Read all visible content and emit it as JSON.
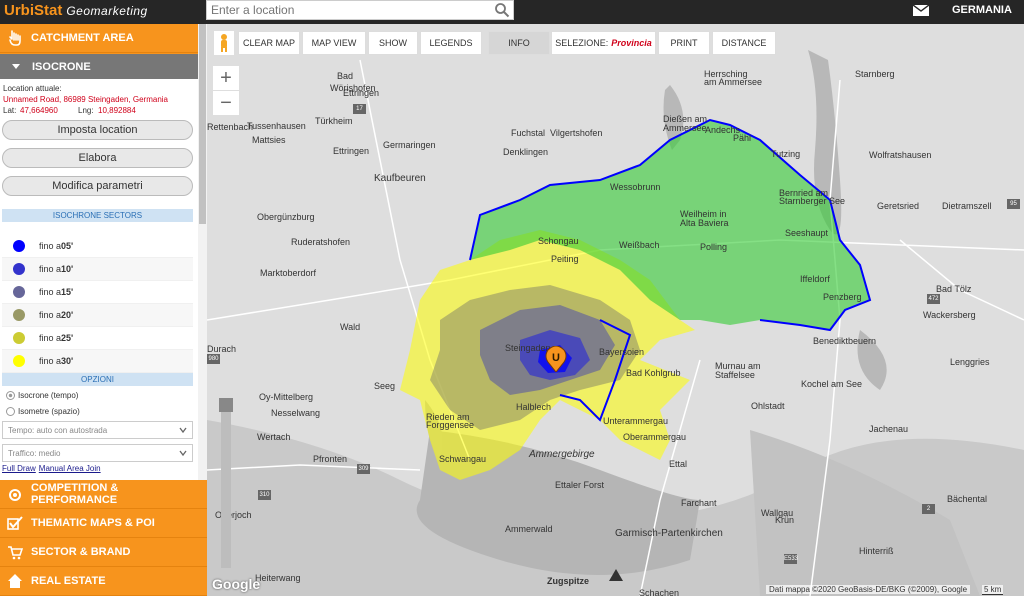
{
  "topbar": {
    "brand_main": "UrbiStat",
    "brand_sub": "Geomarketing",
    "search_placeholder": "Enter a location",
    "country": "GERMANIA"
  },
  "sidebar": {
    "catchment_area": "CATCHMENT AREA",
    "isocrone": "ISOCRONE",
    "location_label": "Location attuale:",
    "location_value": "Unnamed Road, 86989 Steingaden, Germania",
    "lat_label": "Lat:",
    "lat_value": "47,664960",
    "lng_label": "Lng:",
    "lng_value": "10,892884",
    "btn_imposta": "Imposta location",
    "btn_elabora": "Elabora",
    "btn_modifica": "Modifica parametri",
    "sectors_title": "ISOCHRONE SECTORS",
    "sectors": [
      {
        "label": "fino a ",
        "time": "05'",
        "color": "#0000ff"
      },
      {
        "label": "fino a ",
        "time": "10'",
        "color": "#3333cc"
      },
      {
        "label": "fino a ",
        "time": "15'",
        "color": "#666699"
      },
      {
        "label": "fino a ",
        "time": "20'",
        "color": "#999966"
      },
      {
        "label": "fino a ",
        "time": "25'",
        "color": "#cccc33"
      },
      {
        "label": "fino a ",
        "time": "30'",
        "color": "#ffff00"
      }
    ],
    "options_title": "OPZIONI",
    "radio_isocrone": "Isocrone (tempo)",
    "radio_isometre": "Isometre (spazio)",
    "select_tempo": "Tempo: auto con autostrada",
    "select_traffico": "Traffico: medio",
    "link_full_draw": "Full Draw",
    "link_manual": "Manual Area Join",
    "competition": "COMPETITION & PERFORMANCE",
    "thematic": "THEMATIC MAPS & POI",
    "sector_brand": "SECTOR & BRAND",
    "real_estate": "REAL ESTATE"
  },
  "toolbar": {
    "clear_map": "CLEAR MAP",
    "map_view": "MAP VIEW",
    "show": "SHOW",
    "legends": "LEGENDS",
    "info": "INFO",
    "selezione_label": "SELEZIONE:",
    "selezione_value": "Provincia",
    "print": "PRINT",
    "distance": "DISTANCE"
  },
  "map": {
    "zoom_in": "+",
    "zoom_out": "−",
    "google": "Google",
    "attribution": "Dati mappa ©2020 GeoBasis-DE/BKG (©2009), Google",
    "scale": "5 km",
    "places": [
      {
        "name": "Bad"
      },
      {
        "name": "Wörishofen"
      },
      {
        "name": "Ettringen"
      },
      {
        "name": "Türkheim"
      },
      {
        "name": "Tussenhausen"
      },
      {
        "name": "Mattsies"
      },
      {
        "name": "Ettringen"
      },
      {
        "name": "Herrsching"
      },
      {
        "name": "am Ammersee"
      },
      {
        "name": "Starnberg"
      },
      {
        "name": "Fuchstal"
      },
      {
        "name": "Vilgertshofen"
      },
      {
        "name": "Dießen am"
      },
      {
        "name": "Ammersee"
      },
      {
        "name": "Andechs"
      },
      {
        "name": "Tutzing"
      },
      {
        "name": "Wolfratshausen"
      },
      {
        "name": "Germaringen"
      },
      {
        "name": "Denklingen"
      },
      {
        "name": "Kaufbeuren"
      },
      {
        "name": "Obergünzburg"
      },
      {
        "name": "Ruderatshofen"
      },
      {
        "name": "Marktoberdorf"
      },
      {
        "name": "Wald"
      },
      {
        "name": "Seeg"
      },
      {
        "name": "Oy-Mittelberg"
      },
      {
        "name": "Nesselwang"
      },
      {
        "name": "Wertach"
      },
      {
        "name": "Pfronten"
      },
      {
        "name": "Weißbach"
      },
      {
        "name": "Wessobrunn"
      },
      {
        "name": "Weilheim in"
      },
      {
        "name": "Alta Baviera"
      },
      {
        "name": "Polling"
      },
      {
        "name": "Bernried am"
      },
      {
        "name": "Starnberger See"
      },
      {
        "name": "Seeshaupt"
      },
      {
        "name": "Iffeldorf"
      },
      {
        "name": "Penzberg"
      },
      {
        "name": "Geretsried"
      },
      {
        "name": "Dietramszell"
      },
      {
        "name": "Bad Tölz"
      },
      {
        "name": "Wackersberg"
      },
      {
        "name": "Benediktbeuern"
      },
      {
        "name": "Lenggries"
      },
      {
        "name": "Murnau am"
      },
      {
        "name": "Staffelsee"
      },
      {
        "name": "Kochel am See"
      },
      {
        "name": "Ohlstadt"
      },
      {
        "name": "Jachenau"
      },
      {
        "name": "Unterammergau"
      },
      {
        "name": "Oberammergau"
      },
      {
        "name": "Ettal"
      },
      {
        "name": "Ammergebirge"
      },
      {
        "name": "Ettaler Forst"
      },
      {
        "name": "Farchant"
      },
      {
        "name": "Wallgau"
      },
      {
        "name": "Krün"
      },
      {
        "name": "Garmisch-Partenkirchen"
      },
      {
        "name": "Ammerwald"
      },
      {
        "name": "Zugspitze"
      },
      {
        "name": "Heiterwang"
      },
      {
        "name": "Schachen"
      },
      {
        "name": "Bächental"
      },
      {
        "name": "Hinterriß"
      },
      {
        "name": "Schongau"
      },
      {
        "name": "Peiting"
      },
      {
        "name": "Steingaden"
      },
      {
        "name": "Bayersoien"
      },
      {
        "name": "Bad Kohlgrub"
      },
      {
        "name": "Halblech"
      },
      {
        "name": "Rieden am"
      },
      {
        "name": "Forggensee"
      },
      {
        "name": "Schwangau"
      },
      {
        "name": "Durach"
      },
      {
        "name": "Rettenbach"
      },
      {
        "name": "Pähl"
      },
      {
        "name": "Oberjoch"
      }
    ]
  }
}
